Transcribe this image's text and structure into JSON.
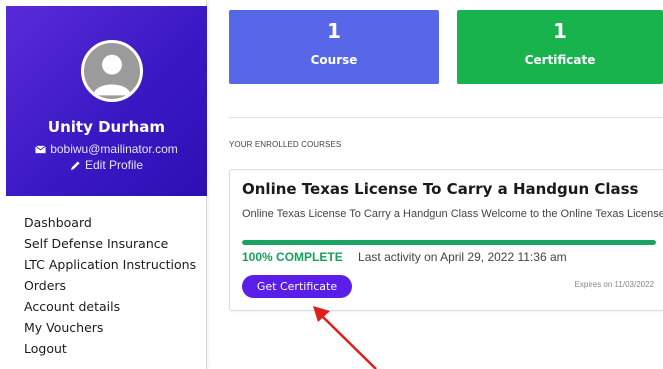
{
  "profile": {
    "name": "Unity Durham",
    "email": "bobiwu@mailinator.com",
    "edit_label": "Edit Profile"
  },
  "menu": {
    "items": [
      {
        "label": "Dashboard"
      },
      {
        "label": "Self Defense Insurance"
      },
      {
        "label": "LTC Application Instructions"
      },
      {
        "label": "Orders"
      },
      {
        "label": "Account details"
      },
      {
        "label": "My Vouchers"
      },
      {
        "label": "Logout"
      }
    ]
  },
  "stats": {
    "course": {
      "count": "1",
      "label": "Course"
    },
    "certificate": {
      "count": "1",
      "label": "Certificate"
    }
  },
  "enrolled": {
    "section_label": "YOUR ENROLLED COURSES",
    "course": {
      "title": "Online Texas License To Carry a Handgun Class",
      "description": "Online Texas License To Carry a Handgun Class Welcome to the Online Texas License...",
      "progress_label": "100% COMPLETE",
      "progress": 1.0,
      "last_activity": "Last activity on April 29, 2022 11:36 am",
      "button_label": "Get Certificate",
      "expires": "Expires on 11/03/2022"
    }
  },
  "colors": {
    "profile_bg": "#3a19c4",
    "course_stat": "#5867e8",
    "certificate_stat": "#18b34c",
    "button": "#5b1ee8",
    "progress": "#1aa463",
    "annotation_arrow": "#e01e1e"
  },
  "icons": {
    "avatar": "user-silhouette-icon",
    "email": "envelope-icon",
    "edit": "pencil-icon",
    "annotation": "red-arrow"
  }
}
